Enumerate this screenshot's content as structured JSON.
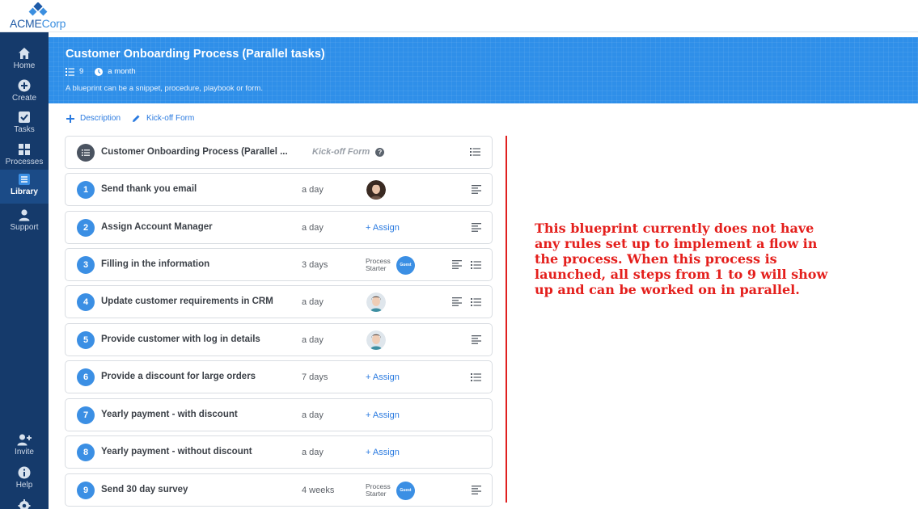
{
  "brand": {
    "part1": "ACME",
    "part2": "Corp"
  },
  "sidebar": {
    "items": [
      {
        "label": "Home",
        "icon": "home-icon",
        "active": false
      },
      {
        "label": "Create",
        "icon": "plus-circle-icon",
        "active": false
      },
      {
        "label": "Tasks",
        "icon": "checkbox-icon",
        "active": false
      },
      {
        "label": "Processes",
        "icon": "grid-icon",
        "active": false
      },
      {
        "label": "Library",
        "icon": "library-icon",
        "active": true
      },
      {
        "label": "Support",
        "icon": "user-icon",
        "active": false
      }
    ],
    "bottom_items": [
      {
        "label": "Invite",
        "icon": "add-user-icon"
      },
      {
        "label": "Help",
        "icon": "info-icon"
      }
    ]
  },
  "header": {
    "title": "Customer Onboarding Process (Parallel tasks)",
    "step_count": "9",
    "updated": "a month",
    "description": "A blueprint can be a snippet, procedure, playbook or form.",
    "background_color": "#2f8fe9"
  },
  "actions": {
    "description_label": "Description",
    "kickoff_label": "Kick-off Form"
  },
  "kickoff_row": {
    "title": "Customer Onboarding Process (Parallel ...",
    "label": "Kick-off Form",
    "help": "?"
  },
  "steps": [
    {
      "number": "1",
      "title": "Send thank you email",
      "deadline": "a day",
      "assignee": "avatar",
      "icons": [
        "notes-icon"
      ]
    },
    {
      "number": "2",
      "title": "Assign Account Manager",
      "deadline": "a day",
      "assignee": "assign",
      "assign_label": "+ Assign",
      "icons": [
        "notes-icon"
      ]
    },
    {
      "number": "3",
      "title": "Filling in the information",
      "deadline": "3 days",
      "assignee": "starter",
      "starter_line1": "Process",
      "starter_line2": "Starter",
      "guest_label": "Guest",
      "icons": [
        "notes-icon",
        "list-icon"
      ]
    },
    {
      "number": "4",
      "title": "Update customer requirements in CRM",
      "deadline": "a day",
      "assignee": "avatar",
      "icons": [
        "notes-icon",
        "list-icon"
      ]
    },
    {
      "number": "5",
      "title": "Provide customer with log in details",
      "deadline": "a day",
      "assignee": "avatar",
      "icons": [
        "notes-icon"
      ]
    },
    {
      "number": "6",
      "title": "Provide a discount for large orders",
      "deadline": "7 days",
      "assignee": "assign",
      "assign_label": "+ Assign",
      "icons": [
        "list-icon"
      ]
    },
    {
      "number": "7",
      "title": "Yearly payment - with discount",
      "deadline": "a day",
      "assignee": "assign",
      "assign_label": "+ Assign",
      "icons": []
    },
    {
      "number": "8",
      "title": "Yearly payment - without discount",
      "deadline": "a day",
      "assignee": "assign",
      "assign_label": "+ Assign",
      "icons": []
    },
    {
      "number": "9",
      "title": "Send 30 day survey",
      "deadline": "4 weeks",
      "assignee": "starter",
      "starter_line1": "Process",
      "starter_line2": "Starter",
      "guest_label": "Guest",
      "icons": [
        "notes-icon"
      ]
    }
  ],
  "annotation": {
    "text": "This blueprint currently does not have any rules set up to implement a flow in the process. When this process is launched, all steps from 1 to 9 will show up and can be worked on in parallel.",
    "color": "#e41f1c"
  }
}
